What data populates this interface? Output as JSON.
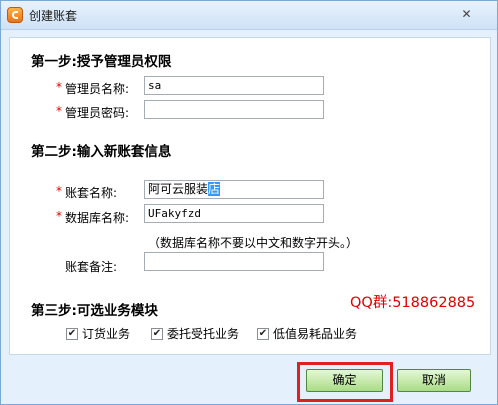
{
  "window": {
    "title": "创建账套",
    "close_glyph": "✕"
  },
  "step1": {
    "heading": "第一步:授予管理员权限",
    "admin_name_label": "管理员名称:",
    "admin_name_value": "sa",
    "admin_password_label": "管理员密码:",
    "admin_password_value": ""
  },
  "step2": {
    "heading": "第二步:输入新账套信息",
    "account_name_label": "账套名称:",
    "account_name_value": "阿可云服装",
    "account_name_selected": "店",
    "db_name_label": "数据库名称:",
    "db_name_value": "UFakyfzd",
    "db_hint": "（数据库名称不要以中文和数字开头。）",
    "remark_label": "账套备注:",
    "remark_value": ""
  },
  "step3": {
    "heading": "第三步:可选业务模块",
    "qq_watermark": "QQ群:518862885",
    "modules": [
      {
        "label": "订货业务",
        "checked": true
      },
      {
        "label": "委托受托业务",
        "checked": true
      },
      {
        "label": "低值易耗品业务",
        "checked": true
      }
    ]
  },
  "required_mark": "*",
  "check_glyph": "✔",
  "buttons": {
    "ok": "确定",
    "cancel": "取消"
  },
  "colors": {
    "required": "#e00000",
    "button_green": "#a9dc86",
    "highlight": "#e02020"
  }
}
